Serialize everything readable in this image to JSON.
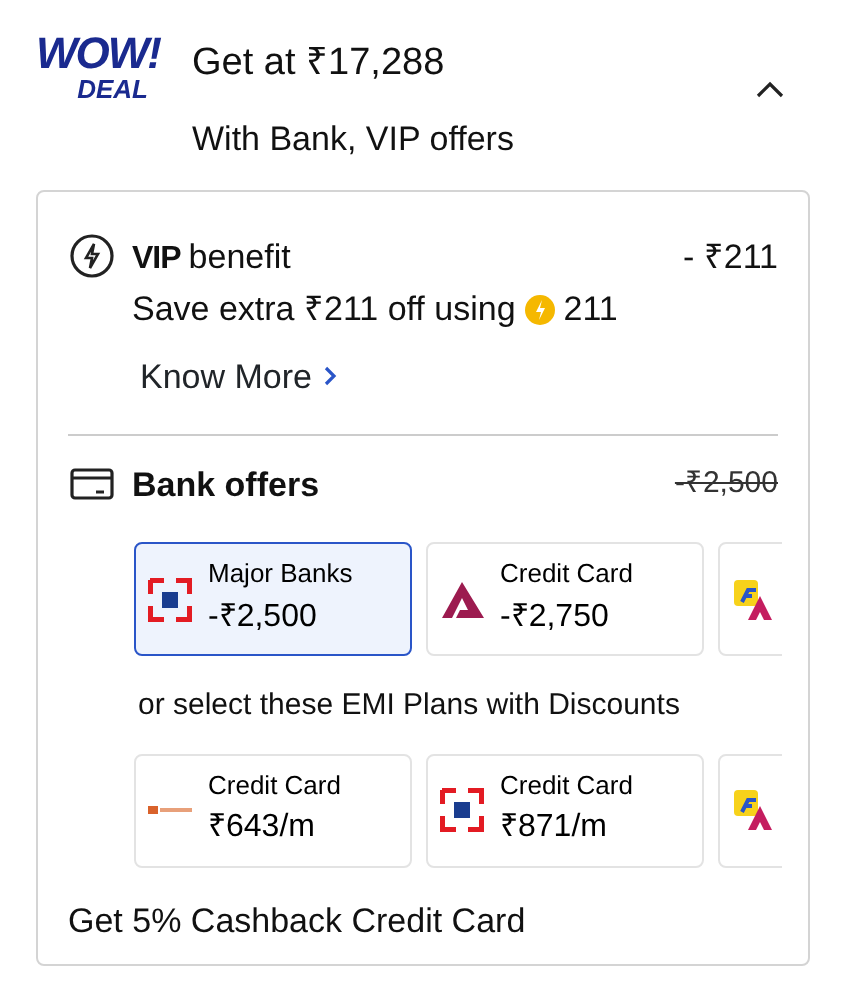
{
  "header": {
    "logo_top": "WOW!",
    "logo_bottom": "DEAL",
    "title": "Get at  ₹17,288",
    "subtitle": "With Bank, VIP offers",
    "expanded": true
  },
  "vip": {
    "badge": "VIP",
    "title": "benefit",
    "amount": "- ₹211",
    "description": "Save extra ₹211 off using",
    "coins": "211",
    "link": "Know More"
  },
  "bank_offers": {
    "title": "Bank offers",
    "amount": "-₹2,500",
    "offers": [
      {
        "kind": "red-square",
        "label": "Major Banks",
        "value": "-₹2,500",
        "selected": true
      },
      {
        "kind": "maroon-a",
        "label": "Credit Card",
        "value": "-₹2,750",
        "selected": false
      },
      {
        "kind": "yellow-tag",
        "selected": false
      }
    ],
    "emi_caption": "or select these EMI Plans with Discounts",
    "emi_plans": [
      {
        "kind": "orange-strip",
        "label": "Credit Card",
        "value": "₹643/m",
        "selected": false
      },
      {
        "kind": "red-square",
        "label": "Credit Card",
        "value": "₹871/m",
        "selected": false
      },
      {
        "kind": "yellow-tag",
        "selected": false
      }
    ]
  },
  "footer_text": "Get 5% Cashback Credit Card"
}
